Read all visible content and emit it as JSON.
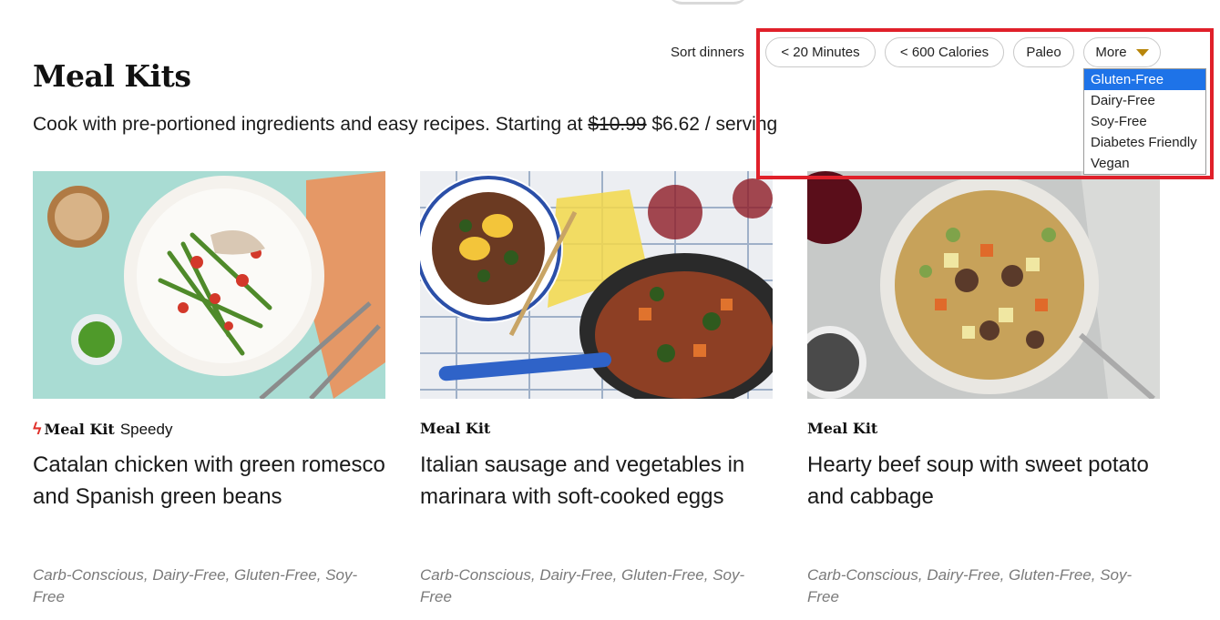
{
  "header": {
    "title": "Meal Kits",
    "subtitle_prefix": "Cook with pre-portioned ingredients and easy recipes. Starting at ",
    "old_price": "$10.99",
    "new_price": "$6.62",
    "subtitle_suffix": "/ serving"
  },
  "filters": {
    "sort_label": "Sort dinners",
    "chips": [
      "< 20 Minutes",
      "< 600 Calories",
      "Paleo"
    ],
    "more_label": "More",
    "more_options": [
      "Gluten-Free",
      "Dairy-Free",
      "Soy-Free",
      "Diabetes Friendly",
      "Vegan"
    ],
    "selected_option": "Gluten-Free"
  },
  "cards": [
    {
      "badge": "Meal Kit",
      "badge_extra": "Speedy",
      "badge_icon": "lightning-bolt-icon",
      "title": "Catalan chicken with green romesco and Spanish green beans",
      "tags": "Carb-Conscious, Dairy-Free, Gluten-Free, Soy-Free"
    },
    {
      "badge": "Meal Kit",
      "title": "Italian sausage and vegetables in marinara with soft-cooked eggs",
      "tags": "Carb-Conscious, Dairy-Free, Gluten-Free, Soy-Free"
    },
    {
      "badge": "Meal Kit",
      "title": "Hearty beef soup with sweet potato and cabbage",
      "tags": "Carb-Conscious, Dairy-Free, Gluten-Free, Soy-Free"
    }
  ],
  "colors": {
    "accent_caret": "#b8860b",
    "dropdown_selected": "#1e73e8",
    "highlight_box": "#e0202a",
    "speedy_bolt": "#e0302a"
  }
}
